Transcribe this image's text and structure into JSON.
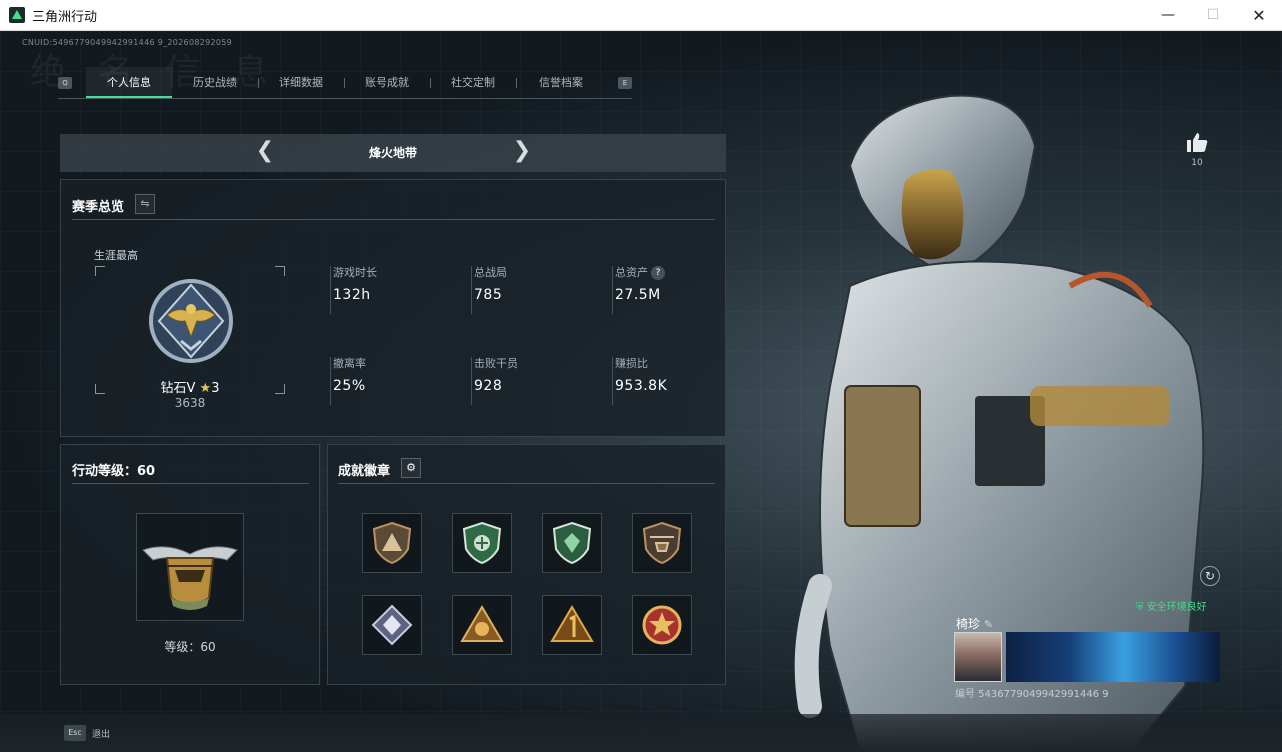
{
  "window": {
    "title": "三角洲行动"
  },
  "uid": "CNUID:5496779049942991446 9_202608292059",
  "watermark": "绝 名 信 息",
  "tabs": {
    "left_key": "Q",
    "right_key": "E",
    "items": [
      "个人信息",
      "历史战绩",
      "详细数据",
      "账号成就",
      "社交定制",
      "信誉档案"
    ],
    "active_index": 0
  },
  "mode": {
    "name": "烽火地带",
    "prev_icon": "chevron-left-icon",
    "next_icon": "chevron-right-icon"
  },
  "season_overview": {
    "title": "赛季总览",
    "career_label": "生涯最高",
    "rank": {
      "name": "钻石V",
      "stars": "3",
      "points": "3638"
    },
    "stats": [
      {
        "label": "游戏时长",
        "value": "132h"
      },
      {
        "label": "总战局",
        "value": "785"
      },
      {
        "label": "总资产",
        "value": "27.5M",
        "help": "?"
      },
      {
        "label": "撤离率",
        "value": "25%"
      },
      {
        "label": "击败干员",
        "value": "928"
      },
      {
        "label": "赚损比",
        "value": "953.8K"
      }
    ]
  },
  "action_level": {
    "title": "行动等级：60",
    "level_text": "等级：60"
  },
  "achievements": {
    "title": "成就徽章",
    "badges": [
      {
        "icon": "shield-triangle-badge-icon",
        "color": "#8a6f4a"
      },
      {
        "icon": "green-shield-badge-icon",
        "color": "#3f8a56"
      },
      {
        "icon": "green-shield-gem-badge-icon",
        "color": "#3b7a4e"
      },
      {
        "icon": "helicopter-shield-badge-icon",
        "color": "#6b5a48"
      },
      {
        "icon": "silver-diamond-badge-icon",
        "color": "#7a7f9a"
      },
      {
        "icon": "gold-triangle-badge-icon",
        "color": "#b07a3a"
      },
      {
        "icon": "number-one-triangle-badge-icon",
        "color": "#9a6a2a"
      },
      {
        "icon": "star-medal-badge-icon",
        "color": "#b23a3a"
      }
    ]
  },
  "profile_card": {
    "like_count": "10",
    "safe_env": "安全环境良好",
    "name": "椅珍",
    "id_text": "编号 5436779049942991446 9"
  },
  "footer": {
    "esc_key": "Esc",
    "esc_label": "退出"
  }
}
